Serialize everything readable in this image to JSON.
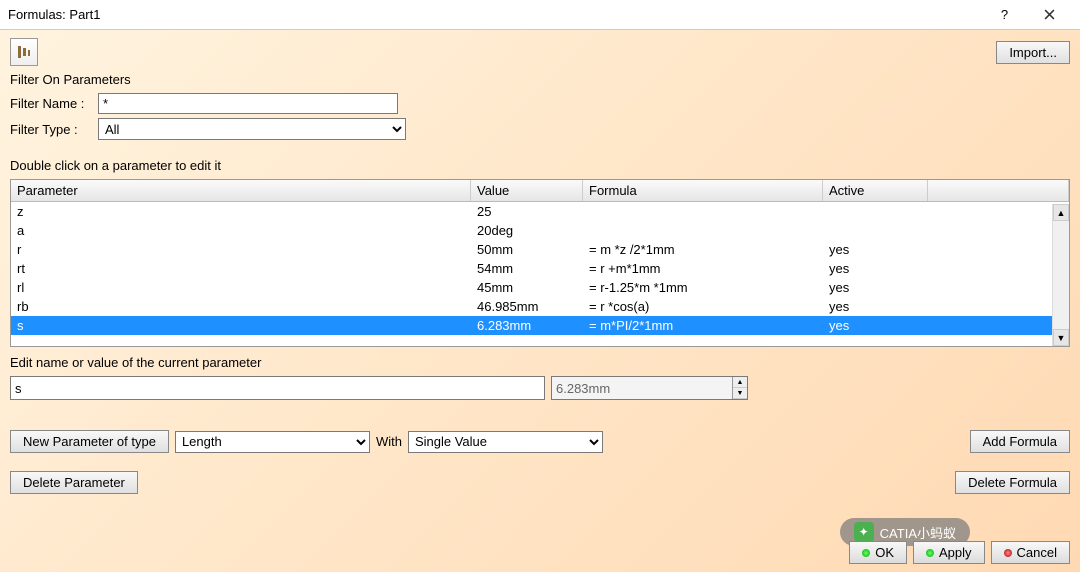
{
  "window": {
    "title": "Formulas: Part1"
  },
  "toolbar": {
    "import": "Import..."
  },
  "filter": {
    "groupLabel": "Filter On Parameters",
    "nameLabel": "Filter Name :",
    "nameValue": "*",
    "typeLabel": "Filter Type :",
    "typeValue": "All"
  },
  "table": {
    "hint": "Double click on a parameter to edit it",
    "headers": {
      "param": "Parameter",
      "value": "Value",
      "formula": "Formula",
      "active": "Active"
    },
    "rows": [
      {
        "param": "z",
        "value": "25",
        "formula": "",
        "active": ""
      },
      {
        "param": "a",
        "value": "20deg",
        "formula": "",
        "active": ""
      },
      {
        "param": "r",
        "value": "50mm",
        "formula": "= m *z /2*1mm",
        "active": "yes"
      },
      {
        "param": "rt",
        "value": "54mm",
        "formula": "= r +m*1mm",
        "active": "yes"
      },
      {
        "param": "rl",
        "value": "45mm",
        "formula": "= r-1.25*m *1mm",
        "active": "yes"
      },
      {
        "param": "rb",
        "value": "46.985mm",
        "formula": "= r *cos(a)",
        "active": "yes"
      },
      {
        "param": "s",
        "value": "6.283mm",
        "formula": "= m*PI/2*1mm",
        "active": "yes",
        "selected": true
      }
    ]
  },
  "edit": {
    "label": "Edit name or value of the current parameter",
    "name": "s",
    "value": "6.283mm"
  },
  "newParam": {
    "button": "New Parameter of type",
    "type": "Length",
    "withLabel": "With",
    "valueType": "Single Value",
    "addFormula": "Add Formula"
  },
  "actions": {
    "deleteParam": "Delete Parameter",
    "deleteFormula": "Delete Formula"
  },
  "dialog": {
    "ok": "OK",
    "apply": "Apply",
    "cancel": "Cancel"
  },
  "watermark": "CATIA小蚂蚁"
}
